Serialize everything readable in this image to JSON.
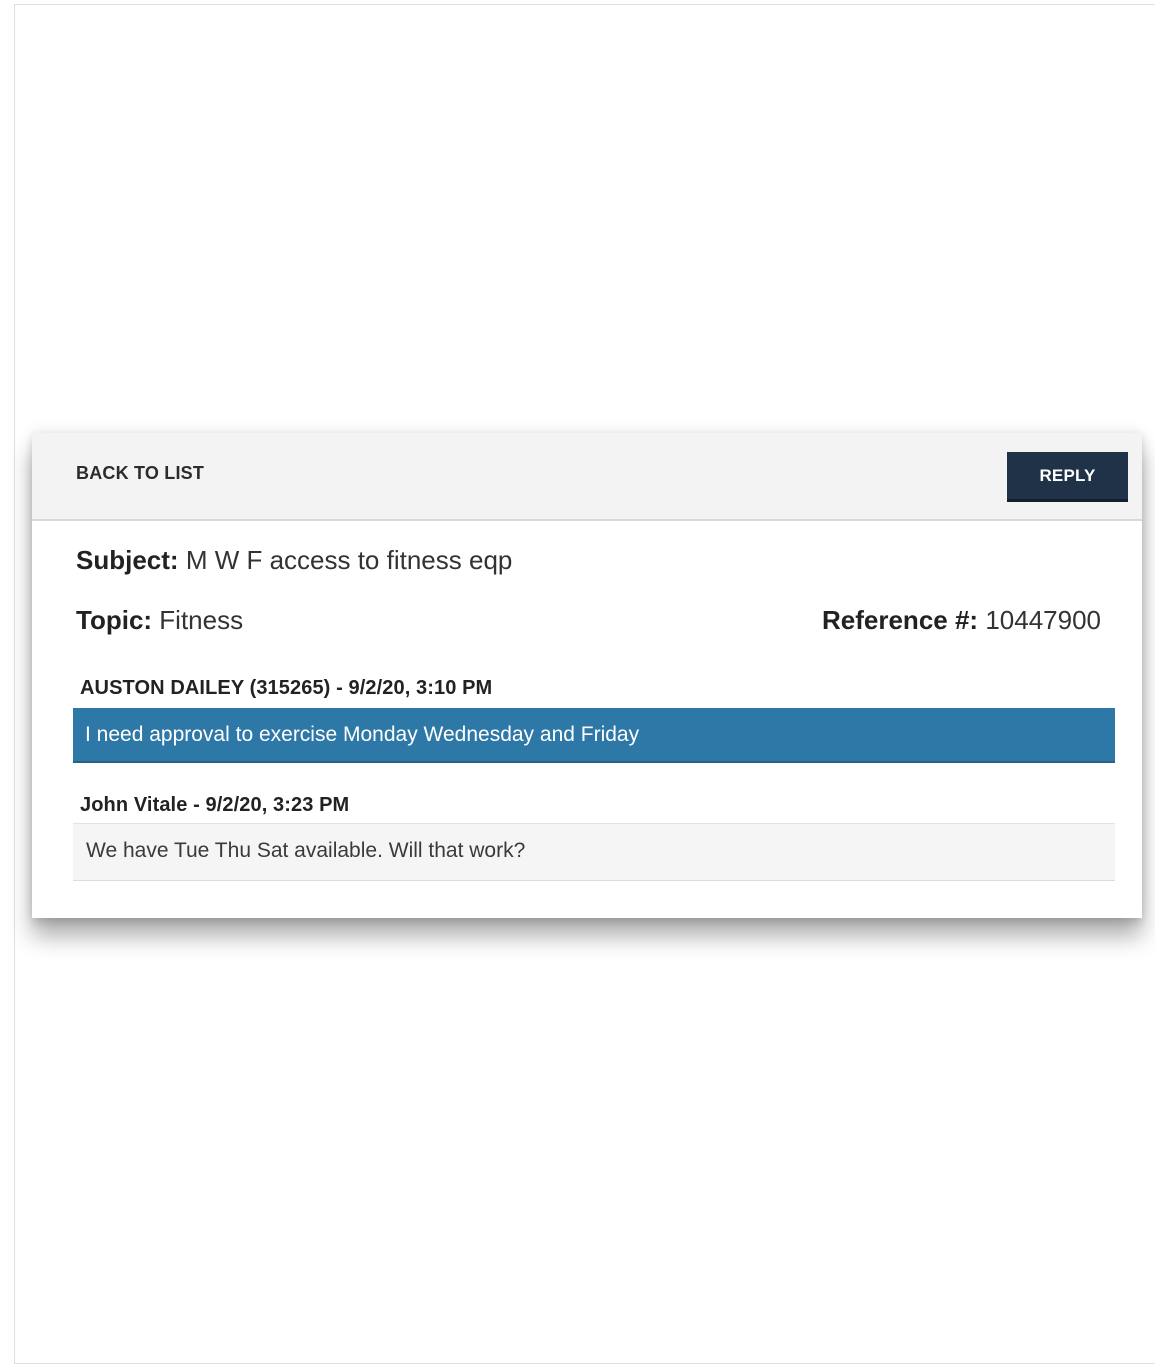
{
  "toolbar": {
    "back_label": "BACK TO LIST",
    "reply_label": "REPLY"
  },
  "details": {
    "subject_label": "Subject:",
    "subject_value": "M W F access to fitness eqp",
    "topic_label": "Topic:",
    "topic_value": "Fitness",
    "reference_label": "Reference #:",
    "reference_value": "10447900"
  },
  "messages": [
    {
      "author": "AUSTON DAILEY (315265) - 9/2/20, 3:10 PM",
      "text": "I need approval to exercise Monday Wednesday and Friday",
      "style": "highlighted",
      "bubble_color": "#2e78a8"
    },
    {
      "author": "John Vitale - 9/2/20, 3:23 PM",
      "text": "We have Tue Thu Sat available. Will that work?",
      "style": "plain",
      "bubble_color": "#f5f5f5"
    }
  ],
  "colors": {
    "reply_button": "#1f3247",
    "toolbar_bg": "#f3f3f3"
  }
}
